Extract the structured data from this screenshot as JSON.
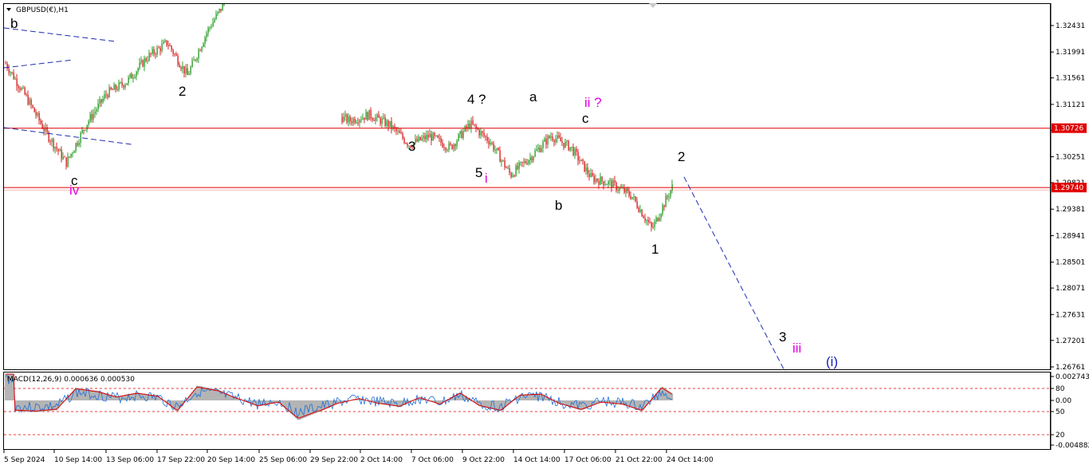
{
  "window": {
    "symbol_label": "GBPUSD(€),H1",
    "menu_arrow_icon": "triangle-down-icon"
  },
  "colors": {
    "bull_candle": "#2ca02c",
    "bear_candle": "#d62728",
    "hline": "#e00000",
    "trend_dashed": "#1f2db0",
    "wave_black": "#000000",
    "wave_magenta": "#e400e4",
    "wave_blue": "#1a22c0",
    "macd_hist": "#b4b4b4",
    "macd_signal": "#e00000",
    "macd_line": "#1e6fd8",
    "price_tag_bg": "#e00000"
  },
  "price_axis": {
    "ticks": [
      "1.32431",
      "1.31991",
      "1.31561",
      "1.31121",
      "1.30691",
      "1.30251",
      "1.29821",
      "1.29381",
      "1.28941",
      "1.28501",
      "1.28071",
      "1.27631",
      "1.27201",
      "1.26761"
    ],
    "tag_upper": "1.30726",
    "tag_lower": "1.29740"
  },
  "time_axis": {
    "labels": [
      "5 Sep 2024",
      "10 Sep 14:00",
      "13 Sep 06:00",
      "17 Sep 22:00",
      "20 Sep 14:00",
      "25 Sep 06:00",
      "29 Sep 22:00",
      "2 Oct 14:00",
      "7 Oct 06:00",
      "9 Oct 22:00",
      "14 Oct 14:00",
      "17 Oct 06:00",
      "21 Oct 22:00",
      "24 Oct 14:00"
    ]
  },
  "macd": {
    "label": "MACD(12,26,9) 0.000636 0.000530",
    "axis_ticks": [
      "0.002743",
      "80",
      "0.00",
      "50",
      "20",
      "-0.004882"
    ]
  },
  "wave_labels": [
    {
      "text": "b",
      "color": "wave_black"
    },
    {
      "text": "2",
      "color": "wave_black"
    },
    {
      "text": "c",
      "color": "wave_black"
    },
    {
      "text": "iv",
      "color": "wave_magenta"
    },
    {
      "text": "3",
      "color": "wave_black"
    },
    {
      "text": "4 ?",
      "color": "wave_black"
    },
    {
      "text": "5",
      "color": "wave_black"
    },
    {
      "text": "i",
      "color": "wave_magenta"
    },
    {
      "text": "a",
      "color": "wave_black"
    },
    {
      "text": "ii ?",
      "color": "wave_magenta"
    },
    {
      "text": "c",
      "color": "wave_black"
    },
    {
      "text": "b",
      "color": "wave_black"
    },
    {
      "text": "2",
      "color": "wave_black"
    },
    {
      "text": "1",
      "color": "wave_black"
    },
    {
      "text": "3",
      "color": "wave_black"
    },
    {
      "text": "iii",
      "color": "wave_magenta"
    },
    {
      "text": "(i)",
      "color": "wave_blue"
    }
  ],
  "chart_data": {
    "type": "candlestick",
    "symbol": "GBPUSD(€)",
    "timeframe": "H1",
    "ylim": [
      1.2657,
      1.328
    ],
    "horizontal_lines": [
      1.30726,
      1.2974
    ],
    "path_closes": [
      {
        "t": "5 Sep 2024",
        "p": 1.318
      },
      {
        "t": "6 Sep",
        "p": 1.3125
      },
      {
        "t": "9 Sep",
        "p": 1.3065
      },
      {
        "t": "10 Sep 14:00",
        "p": 1.3015
      },
      {
        "t": "11 Sep",
        "p": 1.308
      },
      {
        "t": "12 Sep",
        "p": 1.313
      },
      {
        "t": "13 Sep 06:00",
        "p": 1.315
      },
      {
        "t": "14 Sep",
        "p": 1.319
      },
      {
        "t": "16 Sep",
        "p": 1.3215
      },
      {
        "t": "17 Sep 22:00",
        "p": 1.316
      },
      {
        "t": "18 Sep",
        "p": 1.3235
      },
      {
        "t": "19 Sep",
        "p": 1.329
      },
      {
        "t": "20 Sep 14:00",
        "p": 1.33
      },
      {
        "t": "2 Oct",
        "p": 1.327
      },
      {
        "t": "2 Oct 14:00",
        "p": 1.326
      },
      {
        "t": "3 Oct",
        "p": 1.316
      },
      {
        "t": "4 Oct",
        "p": 1.31
      },
      {
        "t": "7 Oct 06:00",
        "p": 1.3085
      },
      {
        "t": "8 Oct",
        "p": 1.3095
      },
      {
        "t": "9 Oct",
        "p": 1.3078
      },
      {
        "t": "9 Oct 22:00",
        "p": 1.3045
      },
      {
        "t": "10 Oct",
        "p": 1.306
      },
      {
        "t": "11 Oct",
        "p": 1.304
      },
      {
        "t": "14 Oct 14:00",
        "p": 1.308
      },
      {
        "t": "15 Oct",
        "p": 1.305
      },
      {
        "t": "16 Oct",
        "p": 1.2995
      },
      {
        "t": "17 Oct 06:00",
        "p": 1.3025
      },
      {
        "t": "17 Oct",
        "p": 1.306
      },
      {
        "t": "18 Oct",
        "p": 1.304
      },
      {
        "t": "21 Oct",
        "p": 1.299
      },
      {
        "t": "21 Oct 22:00",
        "p": 1.298
      },
      {
        "t": "22 Oct",
        "p": 1.296
      },
      {
        "t": "23 Oct",
        "p": 1.2905
      },
      {
        "t": "24 Oct",
        "p": 1.2975
      }
    ],
    "projection": [
      {
        "t": "24 Oct 14:00",
        "p": 1.3005
      },
      {
        "t": "future",
        "p": 1.2665
      }
    ]
  }
}
